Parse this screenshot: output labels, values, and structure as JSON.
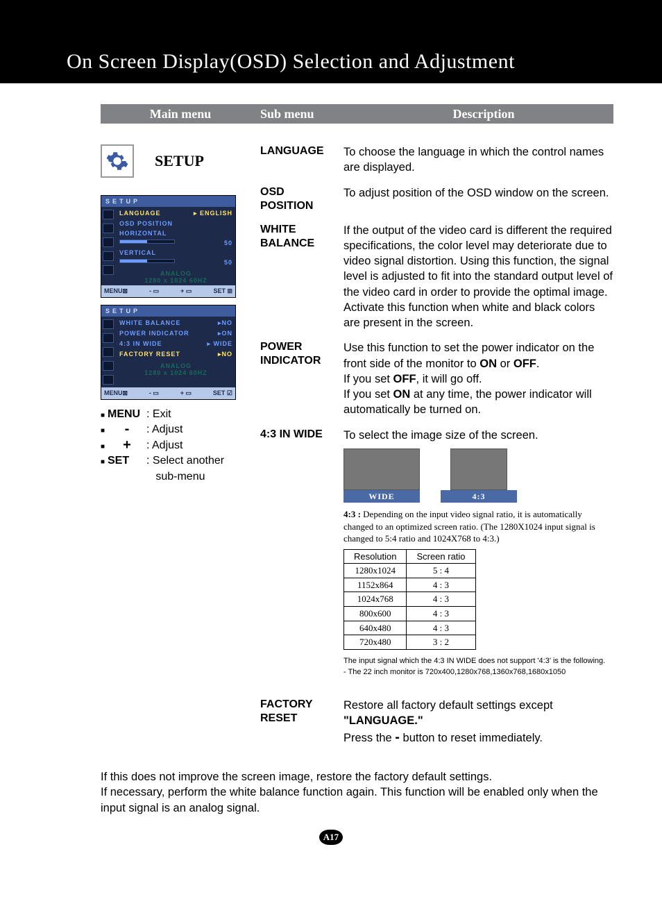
{
  "title": "On Screen Display(OSD) Selection and Adjustment",
  "header": {
    "main": "Main menu",
    "sub": "Sub menu",
    "desc": "Description"
  },
  "main_menu_label": "SETUP",
  "osd1": {
    "title": "SETUP",
    "rows": {
      "language_label": "LANGUAGE",
      "language_val": "ENGLISH",
      "osd_pos": "OSD POSITION",
      "horiz": "HORIZONTAL",
      "horiz_val": "50",
      "vert": "VERTICAL",
      "vert_val": "50",
      "analog": "ANALOG",
      "mode": "1280 x 1024  60HZ"
    },
    "bottom": {
      "menu": "MENU",
      "minus": "-",
      "plus": "+",
      "set": "SET"
    }
  },
  "osd2": {
    "title": "SETUP",
    "rows": {
      "wb": "WHITE BALANCE",
      "wb_val": "NO",
      "pi": "POWER INDICATOR",
      "pi_val": "ON",
      "wide": "4:3  IN WIDE",
      "wide_val": "WIDE",
      "fr": "FACTORY RESET",
      "fr_val": "NO",
      "analog": "ANALOG",
      "mode": "1280 x 1024  60HZ"
    },
    "bottom": {
      "menu": "MENU",
      "minus": "-",
      "plus": "+",
      "set": "SET"
    }
  },
  "legend": {
    "menu_key": "MENU",
    "menu_text": ": Exit",
    "minus_key": "-",
    "minus_text": ": Adjust",
    "plus_key": "+",
    "plus_text": ": Adjust",
    "set_key": "SET",
    "set_text_l1": ": Select another",
    "set_text_l2": "  sub-menu"
  },
  "entries": {
    "language": {
      "label": "LANGUAGE",
      "desc": "To choose the language in which the control names are displayed."
    },
    "osd_position": {
      "label_l1": "OSD",
      "label_l2": "POSITION",
      "desc": "To adjust position of the OSD window on the screen."
    },
    "white_balance": {
      "label_l1": "WHITE",
      "label_l2": "BALANCE",
      "desc": "If the output of the video card is different the required specifications, the color level may deteriorate due to video signal distortion. Using this function, the signal level is adjusted to fit into the standard output level of the video card in order to provide the optimal image.\nActivate this function when white and black colors are present in the screen."
    },
    "power_indicator": {
      "label_l1": "POWER",
      "label_l2": "INDICATOR",
      "d1": "Use this function to set the power indicator on the front side of the monitor to ",
      "b1": "ON",
      "d2": " or ",
      "b2": "OFF",
      "d3": ".",
      "d4": "If you set ",
      "b3": "OFF",
      "d5": ", it will go off.",
      "d6": "If you set ",
      "b4": "ON",
      "d7": " at any time, the power indicator will automatically be turned on."
    },
    "wide": {
      "label": "4:3 IN WIDE",
      "desc": "To select the image size of the screen.",
      "thumb_wide": "WIDE",
      "thumb_43": "4:3",
      "note_pre": "4:3 : ",
      "note": "Depending on the input video signal ratio, it is automatically changed to an optimized screen ratio. (The 1280X1024 input signal is changed to 5:4 ratio and 1024X768 to 4:3.)",
      "th_res": "Resolution",
      "th_ratio": "Screen ratio",
      "table": [
        {
          "r": "1280x1024",
          "s": "5 : 4"
        },
        {
          "r": "1152x864",
          "s": "4 : 3"
        },
        {
          "r": "1024x768",
          "s": "4 : 3"
        },
        {
          "r": "800x600",
          "s": "4 : 3"
        },
        {
          "r": "640x480",
          "s": "4 : 3"
        },
        {
          "r": "720x480",
          "s": "3 : 2"
        }
      ],
      "tiny1": "The input signal which the 4:3 IN WIDE does not support  '4:3' is the following.",
      "tiny2": " - The 22 inch monitor is 720x400,1280x768,1360x768,1680x1050"
    },
    "factory_reset": {
      "label_l1": "FACTORY",
      "label_l2": "RESET",
      "d1": "Restore all factory default settings except ",
      "b1": "\"LANGUAGE.\"",
      "d2": "Press the  ",
      "sym": "-",
      "d3": "  button to reset immediately."
    }
  },
  "bottom_note": "If this does not improve the screen image, restore the factory default settings.\nIf necessary, perform the white balance function again. This function will be enabled only when the input signal is an analog signal.",
  "page_num": "A17",
  "chart_data": {
    "type": "table",
    "title": "4:3 IN WIDE screen ratio by resolution",
    "columns": [
      "Resolution",
      "Screen ratio"
    ],
    "rows": [
      [
        "1280x1024",
        "5 : 4"
      ],
      [
        "1152x864",
        "4 : 3"
      ],
      [
        "1024x768",
        "4 : 3"
      ],
      [
        "800x600",
        "4 : 3"
      ],
      [
        "640x480",
        "4 : 3"
      ],
      [
        "720x480",
        "3 : 2"
      ]
    ]
  }
}
